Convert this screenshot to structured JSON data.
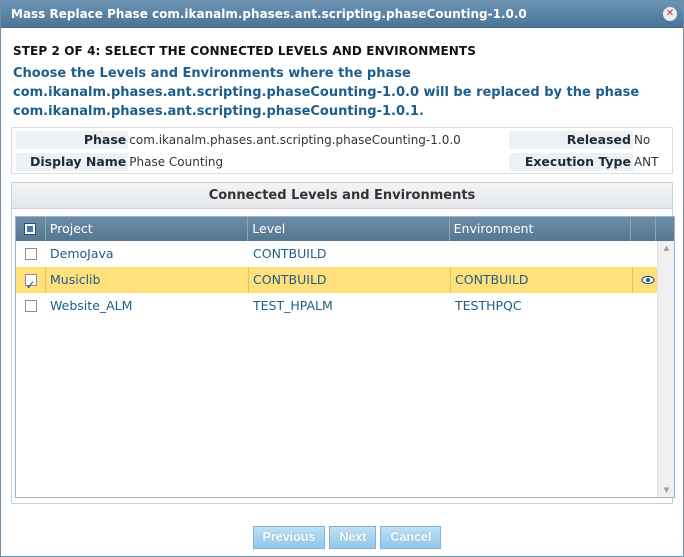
{
  "dialog": {
    "title": "Mass Replace Phase com.ikanalm.phases.ant.scripting.phaseCounting-1.0.0",
    "close_icon": "close-icon"
  },
  "step": {
    "heading": "STEP 2 OF 4: SELECT THE CONNECTED LEVELS AND ENVIRONMENTS",
    "description_line1": "Choose the Levels and Environments where the phase",
    "description_line2": "com.ikanalm.phases.ant.scripting.phaseCounting-1.0.0 will be replaced by the phase",
    "description_line3": "com.ikanalm.phases.ant.scripting.phaseCounting-1.0.1."
  },
  "info": {
    "phase_label": "Phase",
    "phase_value": "com.ikanalm.phases.ant.scripting.phaseCounting-1.0.0",
    "released_label": "Released",
    "released_value": "No",
    "display_name_label": "Display Name",
    "display_name_value": "Phase Counting",
    "execution_type_label": "Execution Type",
    "execution_type_value": "ANT"
  },
  "grid": {
    "title": "Connected Levels and Environments",
    "columns": {
      "project": "Project",
      "level": "Level",
      "environment": "Environment"
    },
    "rows": [
      {
        "checked": false,
        "project": "DemoJava",
        "level": "CONTBUILD",
        "environment": "",
        "selected": false
      },
      {
        "checked": true,
        "project": "Musiclib",
        "level": "CONTBUILD",
        "environment": "CONTBUILD",
        "selected": true
      },
      {
        "checked": false,
        "project": "Website_ALM",
        "level": "TEST_HPALM",
        "environment": "TESTHPQC",
        "selected": false
      }
    ]
  },
  "buttons": {
    "previous": "Previous",
    "next": "Next",
    "cancel": "Cancel"
  },
  "colors": {
    "title_bar": "#56809f",
    "description_text": "#1d5e8c",
    "selected_row": "#ffe07a",
    "table_header": "#5f8099",
    "button": "#a8d3ef"
  }
}
